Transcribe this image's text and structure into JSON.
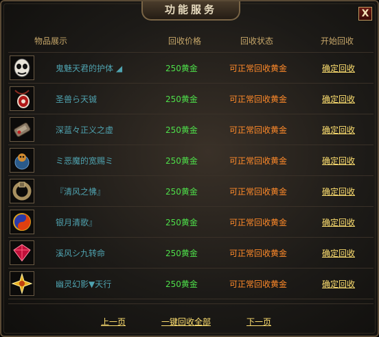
{
  "window": {
    "title": "功能服务",
    "close_label": "X"
  },
  "columns": {
    "item": "物品展示",
    "price": "回收价格",
    "status": "回收状态",
    "action": "开始回收"
  },
  "items": [
    {
      "name": "鬼魅天君的护体 ◢",
      "price": "250黄金",
      "status": "可正常回收黄金",
      "action": "确定回收",
      "icon": "skull-mask-icon"
    },
    {
      "name": "圣兽ら天铖",
      "price": "250黄金",
      "status": "可正常回收黄金",
      "action": "确定回收",
      "icon": "red-pendant-icon"
    },
    {
      "name": "深蓝々正义之虚",
      "price": "250黄金",
      "status": "可正常回收黄金",
      "action": "确定回收",
      "icon": "bracer-icon"
    },
    {
      "name": "ミ恶魔的宽赐ミ",
      "price": "250黄金",
      "status": "可正常回收黄金",
      "action": "确定回收",
      "icon": "demon-ring-icon"
    },
    {
      "name": "『清风之怫』",
      "price": "250黄金",
      "status": "可正常回收黄金",
      "action": "确定回收",
      "icon": "gold-ring-icon"
    },
    {
      "name": "银月清歌』",
      "price": "250黄金",
      "status": "可正常回收黄金",
      "action": "确定回收",
      "icon": "yin-yang-icon"
    },
    {
      "name": "溪风シ九转命",
      "price": "250黄金",
      "status": "可正常回收黄金",
      "action": "确定回收",
      "icon": "ruby-gem-icon"
    },
    {
      "name": "幽灵幻影▼天行",
      "price": "250黄金",
      "status": "可正常回收黄金",
      "action": "确定回收",
      "icon": "gold-sun-icon"
    }
  ],
  "footer": {
    "prev": "上一页",
    "recycle_all": "一键回收全部",
    "next": "下一页"
  },
  "colors": {
    "name": "#4fa3b0",
    "price": "#4ee04a",
    "status": "#ff8a2a",
    "link": "#ffe070",
    "header": "#c8a86a"
  }
}
